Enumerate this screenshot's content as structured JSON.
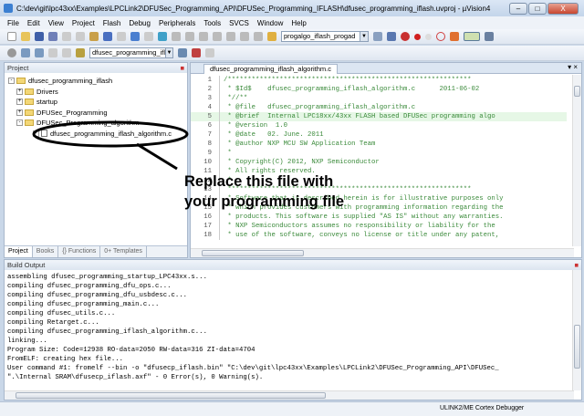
{
  "title": "C:\\dev\\git\\lpc43xx\\Examples\\LPCLink2\\DFUSec_Programming_API\\DFUSec_Programming_IFLASH\\dfusec_programming_iflash.uvproj - µVision4",
  "window_controls": [
    "–",
    "□",
    "X"
  ],
  "menu": [
    "File",
    "Edit",
    "View",
    "Project",
    "Flash",
    "Debug",
    "Peripherals",
    "Tools",
    "SVCS",
    "Window",
    "Help"
  ],
  "toolbar": {
    "target_combo": "progalgo_iflash_progad",
    "project_combo": "dfusec_programming_ifl"
  },
  "project_panel": {
    "title": "Project",
    "tree": [
      {
        "label": "dfusec_programming_iflash",
        "level": 0,
        "toggle": "-"
      },
      {
        "label": "Drivers",
        "level": 1,
        "toggle": "+"
      },
      {
        "label": "startup",
        "level": 1,
        "toggle": "+"
      },
      {
        "label": "DFUSec_Programming",
        "level": 1,
        "toggle": "+"
      },
      {
        "label": "DFUSec_Programming_algorithm",
        "level": 1,
        "toggle": "-"
      },
      {
        "label": "dfusec_programming_iflash_algorithm.c",
        "level": 2,
        "toggle": "+"
      }
    ],
    "tabs": [
      "Project",
      "Books",
      "{} Functions",
      "0+ Templates"
    ]
  },
  "editor": {
    "tab": "dfusec_programming_iflash_algorithm.c",
    "lines": [
      "/*************************************************************",
      " * $Id$    dfusec_programming_iflash_algorithm.c      2011-06-02",
      " *//**",
      " * @file   dfusec_programming_iflash_algorithm.c",
      " * @brief  Internal LPC18xx/43xx FLASH based DFUSec programming algo",
      " * @version  1.0",
      " * @date   02. June. 2011",
      " * @author NXP MCU SW Application Team",
      " *",
      " * Copyright(C) 2012, NXP Semiconductor",
      " * All rights reserved.",
      " *",
      " *************************************************************",
      " * Software that is described herein is for illustrative purposes only",
      " * which provides customers with programming information regarding the",
      " * products. This software is supplied \"AS IS\" without any warranties.",
      " * NXP Semiconductors assumes no responsibility or liability for the",
      " * use of the software, conveys no license or title under any patent,"
    ]
  },
  "callout": {
    "line1": "Replace this file with",
    "line2": "your programming file"
  },
  "build_output": {
    "title": "Build Output",
    "lines": [
      "assembling dfusec_programming_startup_LPC43xx.s...",
      "compiling dfusec_programming_dfu_ops.c...",
      "compiling dfusec_programming_dfu_usbdesc.c...",
      "compiling dfusec_programming_main.c...",
      "compiling dfusec_utils.c...",
      "compiling Retarget.c...",
      "compiling dfusec_programming_iflash_algorithm.c...",
      "linking...",
      "Program Size: Code=12938 RO-data=2050 RW-data=316 ZI-data=4704",
      "FromELF: creating hex file...",
      "User command #1: fromelf --bin -o \"dfusecp_iflash.bin\" \"C:\\dev\\git\\lpc43xx\\Examples\\LPCLink2\\DFUSec_Programming_API\\DFUSec_",
      "\".\\Internal SRAM\\dfusecp_iflash.axf\" - 0 Error(s), 0 Warning(s)."
    ]
  },
  "status": "ULINK2/ME Cortex Debugger"
}
